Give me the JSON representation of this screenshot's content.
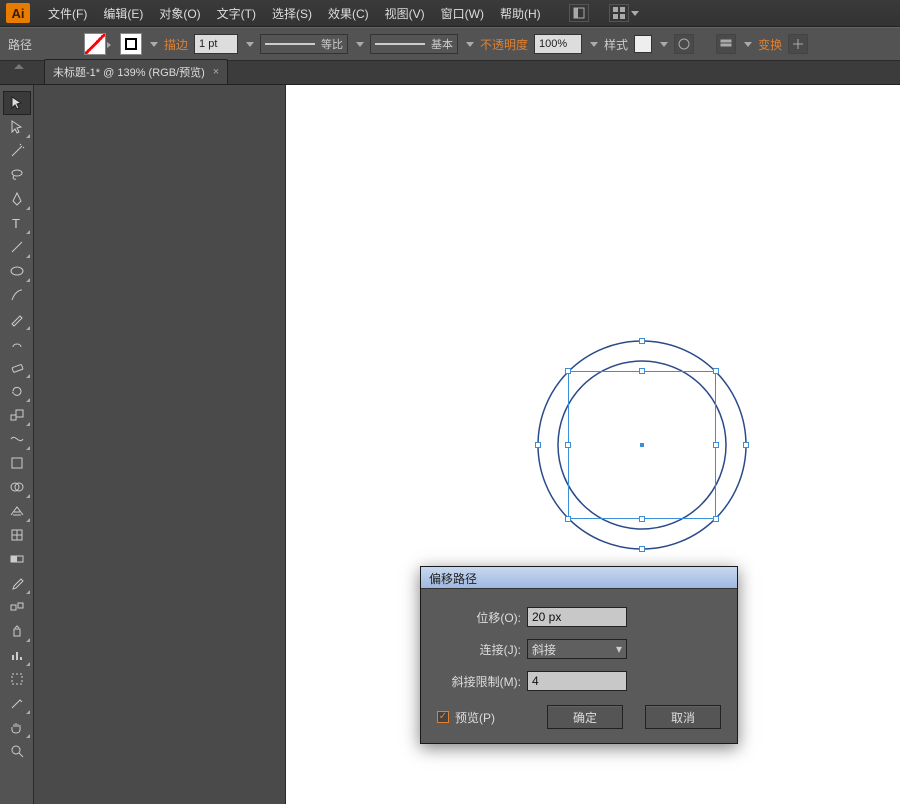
{
  "app": {
    "logo": "Ai"
  },
  "menu": {
    "items": [
      "文件(F)",
      "编辑(E)",
      "对象(O)",
      "文字(T)",
      "选择(S)",
      "效果(C)",
      "视图(V)",
      "窗口(W)",
      "帮助(H)"
    ]
  },
  "options": {
    "selection_label": "路径",
    "stroke_label": "描边",
    "stroke_weight": "1 pt",
    "profile_uniform": "等比",
    "brush_basic": "基本",
    "opacity_label": "不透明度",
    "opacity_value": "100%",
    "style_label": "样式",
    "transform_label": "变换"
  },
  "tab": {
    "title": "未标题-1* @ 139% (RGB/预览)"
  },
  "dialog": {
    "title": "偏移路径",
    "offset_label": "位移(O):",
    "offset_value": "20 px",
    "join_label": "连接(J):",
    "join_value": "斜接",
    "miter_label": "斜接限制(M):",
    "miter_value": "4",
    "preview_label": "预览(P)",
    "preview_checked": true,
    "ok": "确定",
    "cancel": "取消"
  },
  "colors": {
    "accent": "#e08030",
    "selection": "#3a8fd8"
  }
}
